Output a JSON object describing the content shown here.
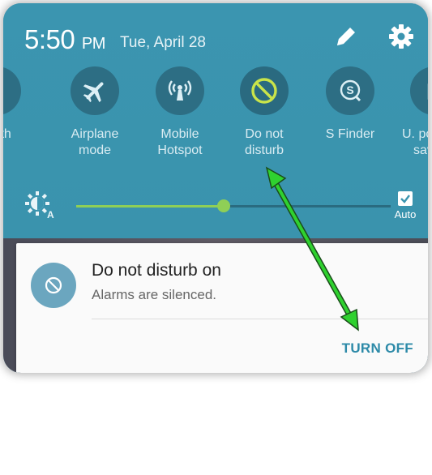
{
  "status": {
    "time": "5:50",
    "ampm": "PM",
    "date": "Tue, April 28",
    "icons": [
      "edit-icon",
      "gear-icon"
    ]
  },
  "quick_settings": {
    "tiles": [
      {
        "label_line1": "tooth",
        "label_line2": "",
        "icon": "bluetooth-icon",
        "active": false
      },
      {
        "label_line1": "Airplane",
        "label_line2": "mode",
        "icon": "airplane-icon",
        "active": false
      },
      {
        "label_line1": "Mobile",
        "label_line2": "Hotspot",
        "icon": "hotspot-icon",
        "active": false
      },
      {
        "label_line1": "Do not",
        "label_line2": "disturb",
        "icon": "do-not-disturb-icon",
        "active": true
      },
      {
        "label_line1": "S Finder",
        "label_line2": "",
        "icon": "s-finder-icon",
        "active": false
      },
      {
        "label_line1": "U. po",
        "label_line2": "sav",
        "icon": "power-saving-icon",
        "active": false
      }
    ]
  },
  "brightness": {
    "level": 0.47,
    "auto_label": "Auto",
    "auto_checked": true
  },
  "notification": {
    "title": "Do not disturb on",
    "text": "Alarms are silenced.",
    "action": "TURN OFF"
  },
  "colors": {
    "shade": "#3b95b0",
    "tile_circle": "#2d6e84",
    "active_icon": "#c9e44a",
    "slider": "#8fcf56",
    "accent_text": "#2d8aa8",
    "arrow": "#2fd12f"
  }
}
